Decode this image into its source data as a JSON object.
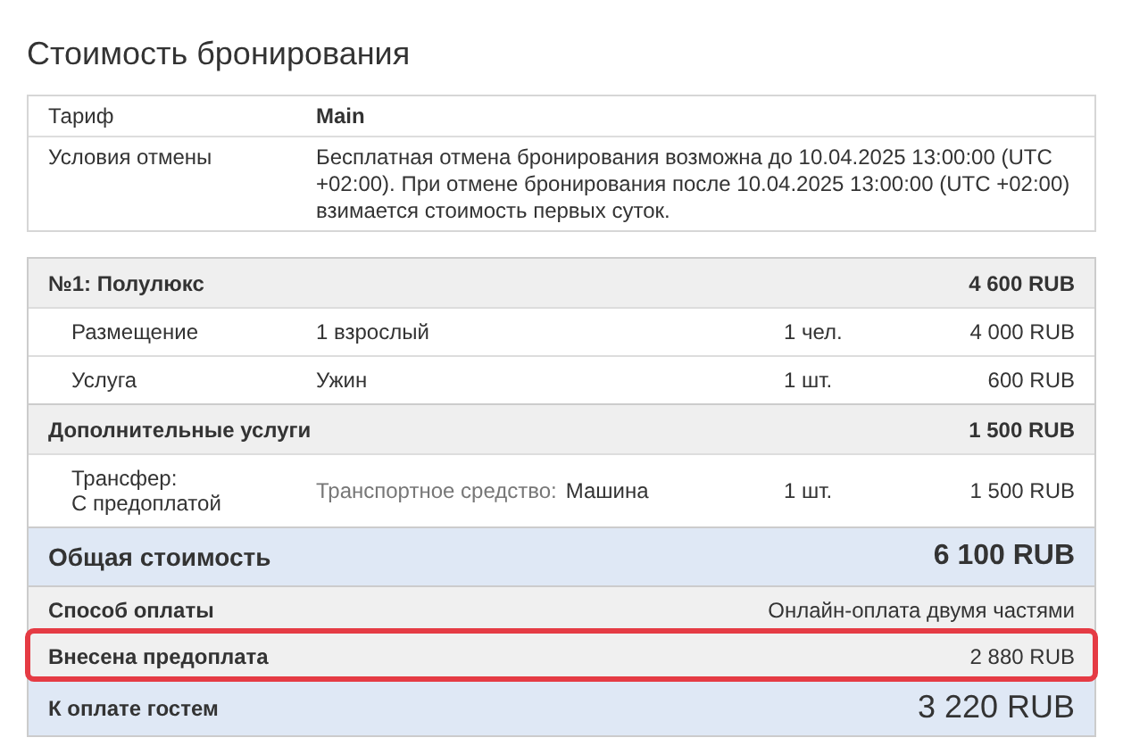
{
  "title": "Стоимость бронирования",
  "details": [
    {
      "label": "Тариф",
      "value": "Main",
      "kind": "strong"
    },
    {
      "label": "Условия отмены",
      "value": "Бесплатная отмена бронирования возможна до 10.04.2025 13:00:00 (UTC +02:00). При отмене бронирования после 10.04.2025 13:00:00 (UTC +02:00) взимается стоимость первых суток.",
      "kind": "plain"
    }
  ],
  "groups": [
    {
      "title": "№1: Полулюкс",
      "amount": "4 600 RUB",
      "items": [
        {
          "name": "Размещение",
          "description": "1 взрослый",
          "quantity": "1 чел.",
          "amount": "4 000 RUB"
        },
        {
          "name": "Услуга",
          "description": "Ужин",
          "quantity": "1 шт.",
          "amount": "600 RUB"
        }
      ]
    },
    {
      "title": "Дополнительные услуги",
      "amount": "1 500 RUB",
      "items": [
        {
          "name": "Трансфер:",
          "note": "С предоплатой",
          "description_label": "Транспортное средство:",
          "description": "Машина",
          "quantity": "1 шт.",
          "amount": "1 500 RUB"
        }
      ]
    }
  ],
  "summary": [
    {
      "kind": "total",
      "label": "Общая стоимость",
      "value": "6 100 RUB",
      "highlighted": false
    },
    {
      "kind": "info",
      "label": "Способ оплаты",
      "value": "Онлайн-оплата двумя частями",
      "highlighted": false
    },
    {
      "kind": "info",
      "label": "Внесена предоплата",
      "value": "2 880 RUB",
      "highlighted": true
    },
    {
      "kind": "due",
      "label": "К оплате гостем",
      "value": "3 220 RUB",
      "highlighted": false
    }
  ]
}
